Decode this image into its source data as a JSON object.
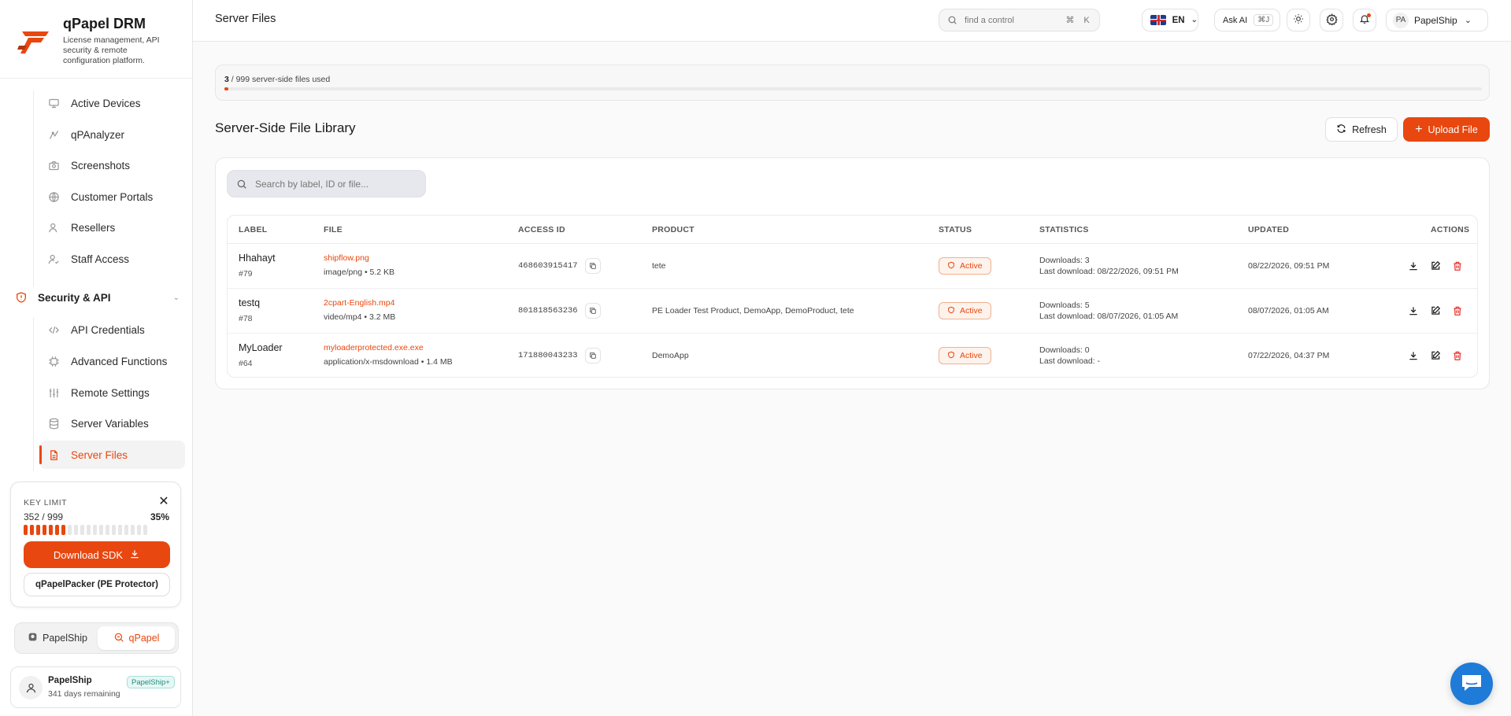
{
  "brand": {
    "title": "qPapel DRM",
    "subtitle": "License management, API security & remote configuration platform."
  },
  "sidebar": {
    "items_top": [
      {
        "label": "Active Devices",
        "icon": "monitor-icon"
      },
      {
        "label": "qPAnalyzer",
        "icon": "analyzer-icon"
      },
      {
        "label": "Screenshots",
        "icon": "camera-icon"
      },
      {
        "label": "Customer Portals",
        "icon": "globe-icon"
      },
      {
        "label": "Resellers",
        "icon": "users-icon"
      },
      {
        "label": "Staff Access",
        "icon": "user-check-icon"
      }
    ],
    "section": {
      "label": "Security & API",
      "icon": "shield-icon"
    },
    "items_section": [
      {
        "label": "API Credentials",
        "icon": "code-icon"
      },
      {
        "label": "Advanced Functions",
        "icon": "cpu-icon"
      },
      {
        "label": "Remote Settings",
        "icon": "sliders-icon"
      },
      {
        "label": "Server Variables",
        "icon": "database-icon"
      },
      {
        "label": "Server Files",
        "icon": "file-icon",
        "active": true
      }
    ]
  },
  "key_limit": {
    "label": "KEY LIMIT",
    "count": "352 / 999",
    "percent_text": "35%",
    "percent": 35,
    "download_sdk": "Download SDK",
    "packer": "qPapelPacker (PE Protector)"
  },
  "switcher": {
    "options": [
      "PapelShip",
      "qPapel"
    ],
    "selected": "qPapel"
  },
  "user_card": {
    "name": "PapelShip",
    "remaining": "341 days remaining",
    "badge": "PapelShip+"
  },
  "topbar": {
    "title": "Server Files",
    "search_placeholder": "find a control",
    "search_kbd": [
      "⌘",
      "K"
    ],
    "lang": "EN",
    "ask_ai": "Ask AI",
    "ask_ai_kbd": "⌘J",
    "user_initials": "PA",
    "user_name": "PapelShip"
  },
  "usage": {
    "used": "3",
    "rest": " / 999 server-side files used",
    "fraction": 0.003
  },
  "library": {
    "title": "Server-Side File Library",
    "refresh": "Refresh",
    "upload": "Upload File",
    "search_placeholder": "Search by label, ID or file..."
  },
  "table": {
    "headers": {
      "label": "LABEL",
      "file": "FILE",
      "access_id": "ACCESS ID",
      "product": "PRODUCT",
      "status": "STATUS",
      "statistics": "STATISTICS",
      "updated": "UPDATED",
      "actions": "ACTIONS"
    },
    "rows": [
      {
        "label": "Hhahayt",
        "id": "#79",
        "file": "shipflow.png",
        "meta": "image/png • 5.2 KB",
        "access_id": "468603915417",
        "product": "tete",
        "status": "Active",
        "downloads": "Downloads: 3",
        "last_download": "Last download: 08/22/2026, 09:51 PM",
        "updated": "08/22/2026, 09:51 PM"
      },
      {
        "label": "testq",
        "id": "#78",
        "file": "2cpart-English.mp4",
        "meta": "video/mp4 • 3.2 MB",
        "access_id": "801818563236",
        "product": "PE Loader Test Product, DemoApp, DemoProduct, tete",
        "status": "Active",
        "downloads": "Downloads: 5",
        "last_download": "Last download: 08/07/2026, 01:05 AM",
        "updated": "08/07/2026, 01:05 AM"
      },
      {
        "label": "MyLoader",
        "id": "#64",
        "file": "myloaderprotected.exe.exe",
        "meta": "application/x-msdownload • 1.4 MB",
        "access_id": "171880043233",
        "product": "DemoApp",
        "status": "Active",
        "downloads": "Downloads: 0",
        "last_download": "Last download: -",
        "updated": "07/22/2026, 04:37 PM"
      }
    ]
  },
  "colors": {
    "accent": "#e8470f",
    "chat": "#1e7bd8"
  }
}
